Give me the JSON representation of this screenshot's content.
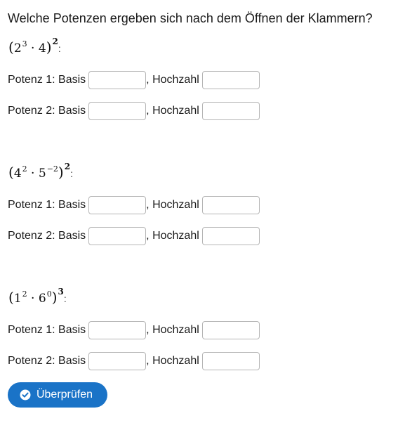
{
  "question": "Welche Potenzen ergeben sich nach dem Öffnen der Klammern?",
  "labels": {
    "potenz1": "Potenz 1: Basis",
    "potenz2": "Potenz 2: Basis",
    "hochzahl": ", Hochzahl"
  },
  "tasks": [
    {
      "base1": "2",
      "exp1": "3",
      "dot": "·",
      "base2": "4",
      "exp2": "",
      "outer_exp": "2"
    },
    {
      "base1": "4",
      "exp1": "2",
      "dot": "·",
      "base2": "5",
      "exp2": "−2",
      "outer_exp": "2"
    },
    {
      "base1": "1",
      "exp1": "2",
      "dot": "·",
      "base2": "6",
      "exp2": "0",
      "outer_exp": "3"
    }
  ],
  "inputs": {
    "basis_value": "",
    "hochzahl_value": ""
  },
  "check_button": {
    "label": "Überprüfen",
    "icon": "check-circle-icon"
  },
  "colors": {
    "button_bg": "#1a73c7",
    "button_text": "#ffffff",
    "input_border": "#b5b5b5"
  }
}
